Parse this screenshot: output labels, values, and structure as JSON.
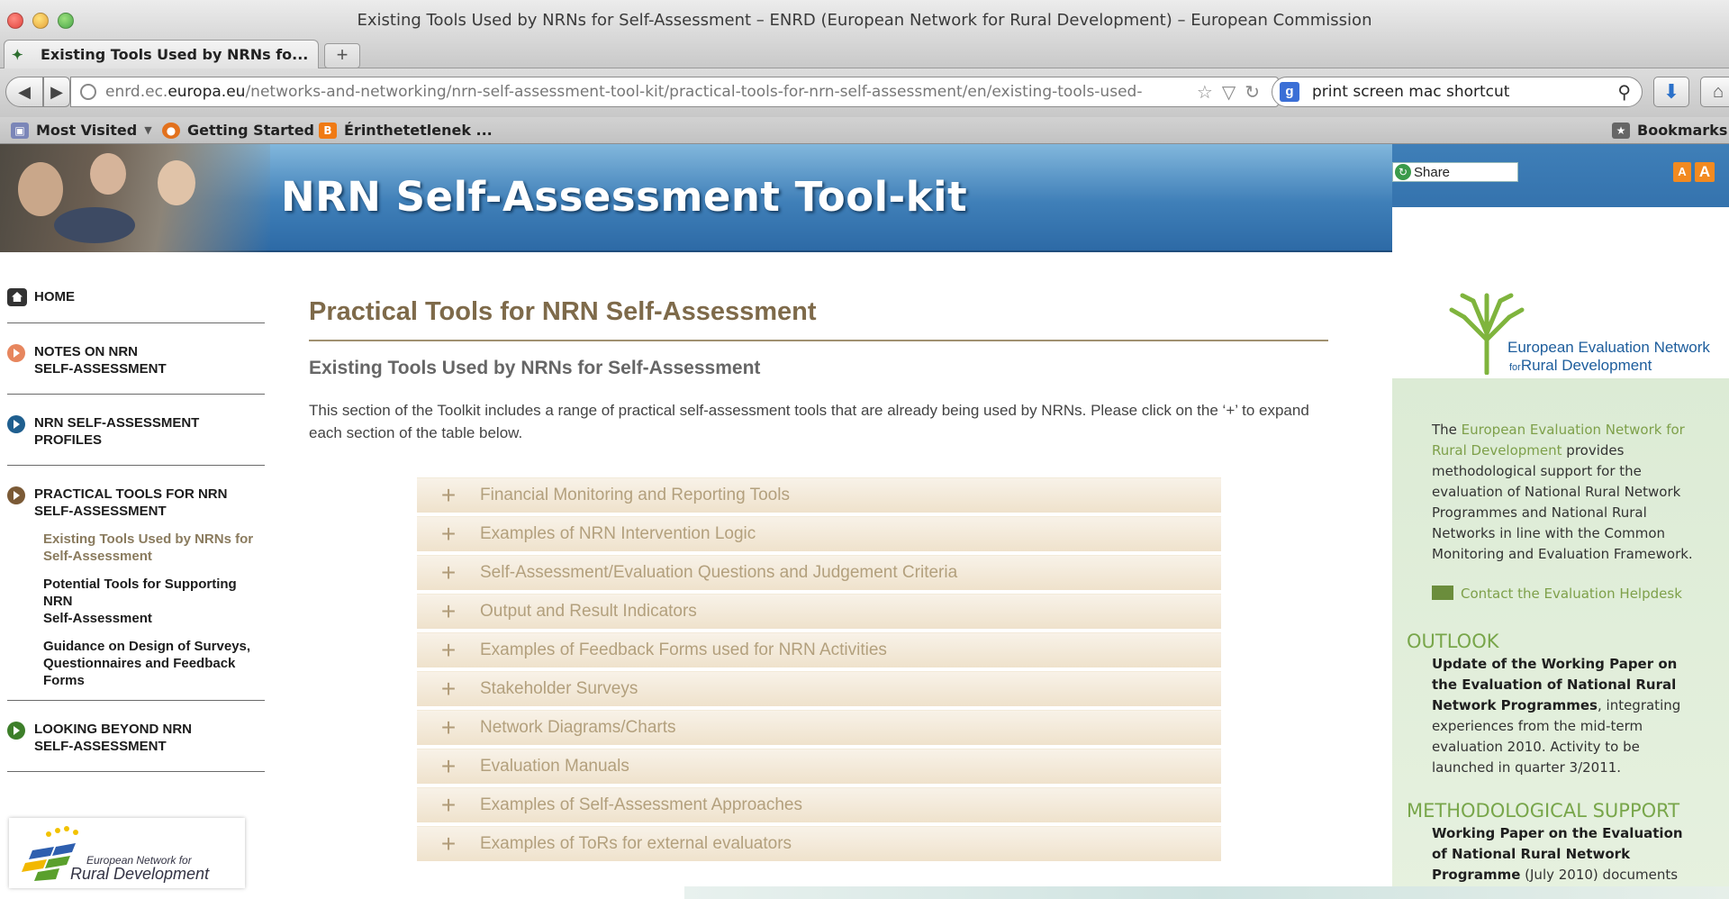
{
  "window": {
    "title": "Existing Tools Used by NRNs for Self-Assessment – ENRD (European Network for Rural Development) – European Commission"
  },
  "tabs": [
    {
      "label": "Existing Tools Used by NRNs fo..."
    }
  ],
  "toolbar": {
    "url_prefix": "enrd.ec.",
    "url_domain": "europa.eu",
    "url_path": "/networks-and-networking/nrn-self-assessment-tool-kit/practical-tools-for-nrn-self-assessment/en/existing-tools-used-",
    "search_value": "print screen mac shortcut",
    "new_tab": "+"
  },
  "bookmarks": {
    "items": [
      {
        "label": "Most Visited",
        "icon": "folder-icon"
      },
      {
        "label": "Getting Started",
        "icon": "firefox-icon"
      },
      {
        "label": "Érinthetetlenek ...",
        "icon": "blogger-icon"
      }
    ],
    "right_label": "Bookmarks"
  },
  "banner": {
    "title": "NRN Self-Assessment Tool-kit",
    "share_label": "Share"
  },
  "nav": {
    "home": "HOME",
    "notes": [
      "NOTES ON NRN",
      "SELF-ASSESSMENT"
    ],
    "profiles": [
      "NRN SELF-ASSESSMENT",
      "PROFILES"
    ],
    "practical": [
      "PRACTICAL TOOLS FOR NRN",
      "SELF-ASSESSMENT"
    ],
    "sub": [
      [
        "Existing Tools Used by NRNs for",
        "Self-Assessment"
      ],
      [
        "Potential Tools for Supporting NRN",
        "Self-Assessment"
      ],
      [
        "Guidance on Design of Surveys,",
        "Questionnaires and Feedback Forms"
      ]
    ],
    "beyond": [
      "LOOKING BEYOND NRN",
      "SELF-ASSESSMENT"
    ],
    "logo_line1": "European Network for",
    "logo_line2": "Rural Development"
  },
  "main": {
    "title": "Practical Tools for NRN Self-Assessment",
    "subtitle": "Existing Tools Used by NRNs for Self-Assessment",
    "intro": "This section of the Toolkit includes a range of practical self-assessment tools that are already being used by NRNs. Please click on the ‘+’ to expand each section of the table below.",
    "sections": [
      "Financial Monitoring and Reporting Tools",
      "Examples of NRN Intervention Logic",
      "Self-Assessment/Evaluation Questions and Judgement Criteria",
      "Output and Result Indicators",
      "Examples of Feedback Forms used for NRN Activities",
      "Stakeholder Surveys",
      "Network Diagrams/Charts",
      "Evaluation Manuals",
      "Examples of Self-Assessment Approaches",
      "Examples of ToRs for external evaluators"
    ]
  },
  "sidebar": {
    "logo_line1": "European Evaluation Network",
    "logo_line2": "Rural Development",
    "logo_for": "for",
    "intro_pre": "The ",
    "intro_link": "European Evaluation Network for Rural Development",
    "intro_post": " provides methodological support for the evaluation of National Rural Network Programmes and National Rural Networks in line with the Common Monitoring and Evaluation Framework.",
    "contact": "Contact the Evaluation Helpdesk",
    "outlook_heading": "OUTLOOK",
    "outlook_bold": "Update of the Working Paper on the Evaluation of National Rural Network Programmes",
    "outlook_text": ", integrating experiences from the mid-term evaluation 2010. Activity to be launched in quarter 3/2011.",
    "method_heading": "METHODOLOGICAL SUPPORT",
    "method_bold": "Working Paper on the Evaluation of National Rural Network Programme",
    "method_text": " (July 2010) documents"
  },
  "colors": {
    "title_brown": "#7e6a4a",
    "accordion_text": "#b3a07d",
    "sidebar_green": "#78a64a",
    "banner_blue": "#3f7fb8"
  }
}
